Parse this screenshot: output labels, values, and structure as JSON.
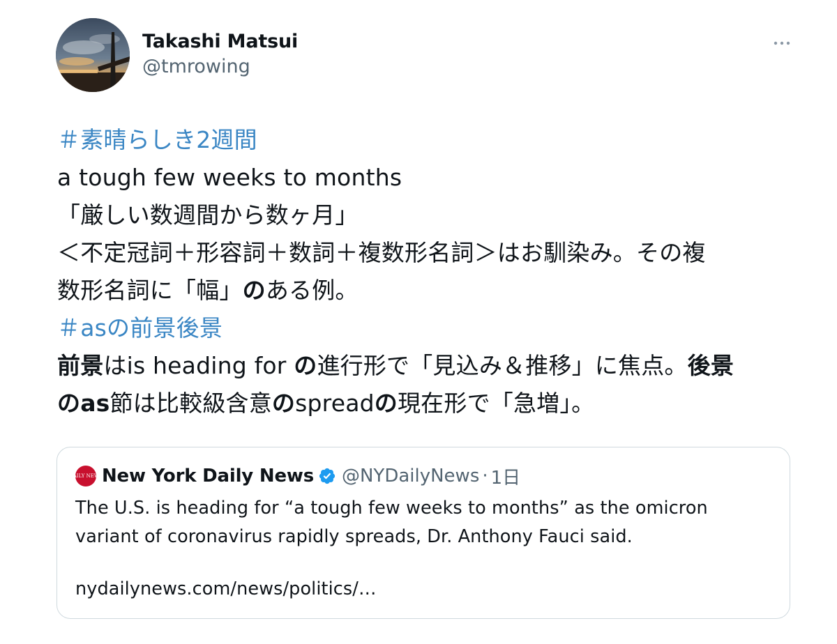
{
  "author": {
    "name": "Takashi Matsui",
    "handle": "@tmrowing",
    "avatar_icon": "sunset-photo-avatar"
  },
  "menu_icon": "more-dots-icon",
  "body": {
    "hashtag1": "＃素晴らしき2週間",
    "line2": "a tough few weeks to months",
    "line3": "「厳しい数週間から数ヶ月」",
    "line4": "＜不定冠詞＋形容詞＋数詞＋複数形名詞＞はお馴染み。その複",
    "line5a": "数形名詞に「幅」",
    "line5b": "の",
    "line5c": "ある例。",
    "hashtag2": "＃asの前景後景",
    "line7a": "前景",
    "line7b": "はis heading for ",
    "line7c": "の",
    "line7d": "進行形で「見込み＆推移」に焦点。",
    "line7e": "後景",
    "line8a": "のas",
    "line8b": "節は比較級含意",
    "line8c": "の",
    "line8d": "spread",
    "line8e": "の",
    "line8f": "現在形で「急増」。"
  },
  "quote": {
    "avatar_text": "DAILY NEWS",
    "name": "New York Daily News",
    "verified_icon": "verified-badge-icon",
    "handle": "@NYDailyNews",
    "dot": "·",
    "time": "1日",
    "text": "The U.S. is heading for “a tough few weeks to months” as the omicron variant of coronavirus rapidly spreads, Dr. Anthony Fauci said.",
    "link": "nydailynews.com/news/politics/…"
  },
  "colors": {
    "hashtag": "#3a86c4",
    "secondary_text": "#536471",
    "verified": "#1d9bf0",
    "border": "#cfd9de",
    "nydn_red": "#c8102e"
  }
}
